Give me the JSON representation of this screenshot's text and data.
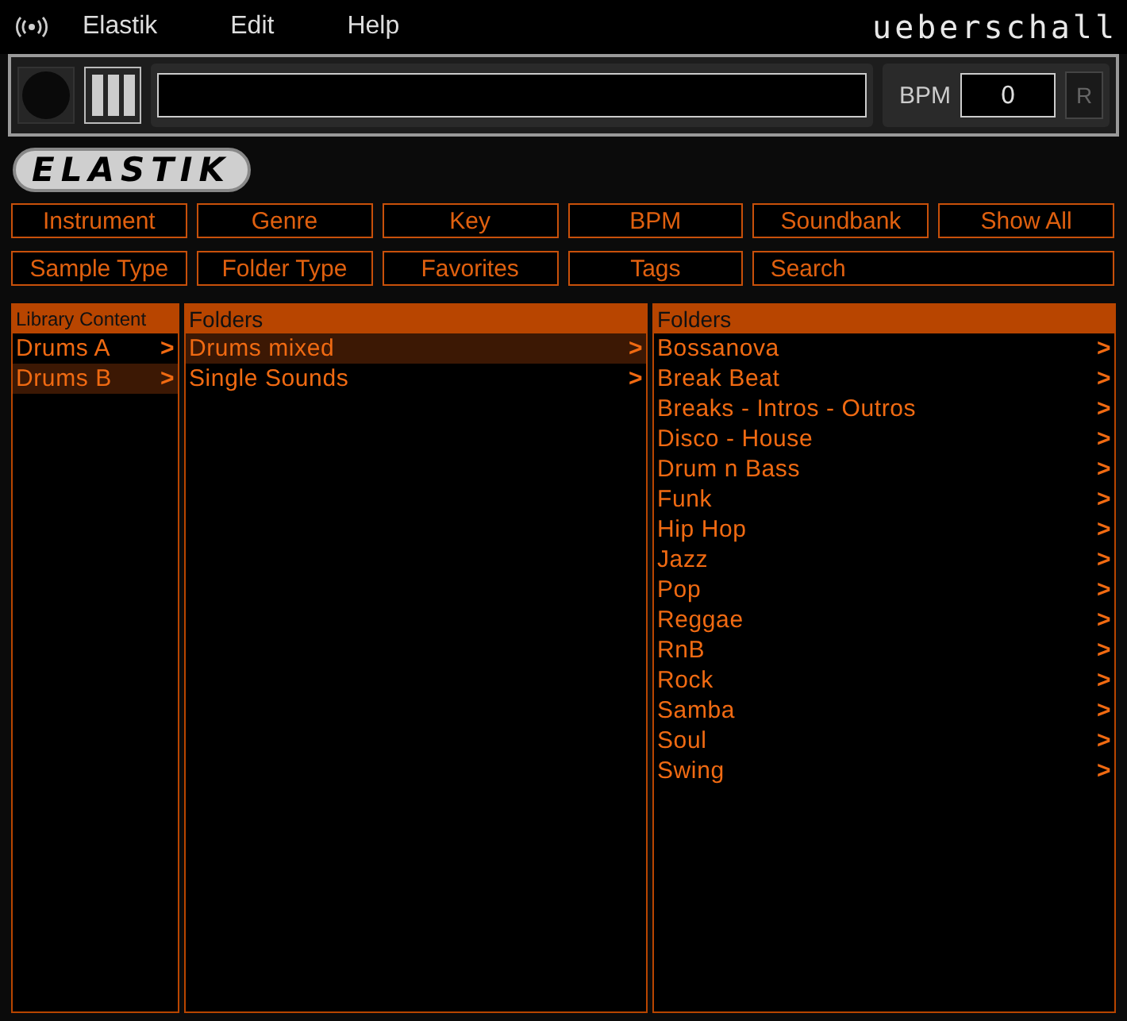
{
  "menu": {
    "items": [
      "Elastik",
      "Edit",
      "Help"
    ],
    "brand": "ueberschall"
  },
  "toolbar": {
    "bpm_label": "BPM",
    "bpm_value": "0",
    "reset_label": "R",
    "play_on": false
  },
  "logo": "ELASTIK",
  "filters": [
    {
      "label": "Instrument",
      "wide": false
    },
    {
      "label": "Genre",
      "wide": false
    },
    {
      "label": "Key",
      "wide": false
    },
    {
      "label": "BPM",
      "wide": false
    },
    {
      "label": "Soundbank",
      "wide": false
    },
    {
      "label": "Show All",
      "wide": false
    },
    {
      "label": "Sample Type",
      "wide": false
    },
    {
      "label": "Folder Type",
      "wide": false
    },
    {
      "label": "Favorites",
      "wide": false
    },
    {
      "label": "Tags",
      "wide": false
    },
    {
      "label": "Search",
      "wide": true
    }
  ],
  "columns": [
    {
      "title": "Library Content",
      "items": [
        {
          "label": "Drums A",
          "arrow": ">",
          "selected": false
        },
        {
          "label": "Drums B",
          "arrow": ">",
          "selected": true
        }
      ]
    },
    {
      "title": "Folders",
      "items": [
        {
          "label": "Drums mixed",
          "arrow": ">",
          "selected": true
        },
        {
          "label": "Single Sounds",
          "arrow": ">",
          "selected": false
        }
      ]
    },
    {
      "title": "Folders",
      "items": [
        {
          "label": "Bossanova",
          "arrow": ">",
          "selected": false
        },
        {
          "label": "Break Beat",
          "arrow": ">",
          "selected": false
        },
        {
          "label": "Breaks - Intros - Outros",
          "arrow": ">",
          "selected": false
        },
        {
          "label": "Disco - House",
          "arrow": ">",
          "selected": false
        },
        {
          "label": "Drum n Bass",
          "arrow": ">",
          "selected": false
        },
        {
          "label": "Funk",
          "arrow": ">",
          "selected": false
        },
        {
          "label": "Hip Hop",
          "arrow": ">",
          "selected": false
        },
        {
          "label": "Jazz",
          "arrow": ">",
          "selected": false
        },
        {
          "label": "Pop",
          "arrow": ">",
          "selected": false
        },
        {
          "label": "Reggae",
          "arrow": ">",
          "selected": false
        },
        {
          "label": "RnB",
          "arrow": ">",
          "selected": false
        },
        {
          "label": "Rock",
          "arrow": ">",
          "selected": false
        },
        {
          "label": "Samba",
          "arrow": ">",
          "selected": false
        },
        {
          "label": "Soul",
          "arrow": ">",
          "selected": false
        },
        {
          "label": "Swing",
          "arrow": ">",
          "selected": false
        }
      ]
    }
  ]
}
